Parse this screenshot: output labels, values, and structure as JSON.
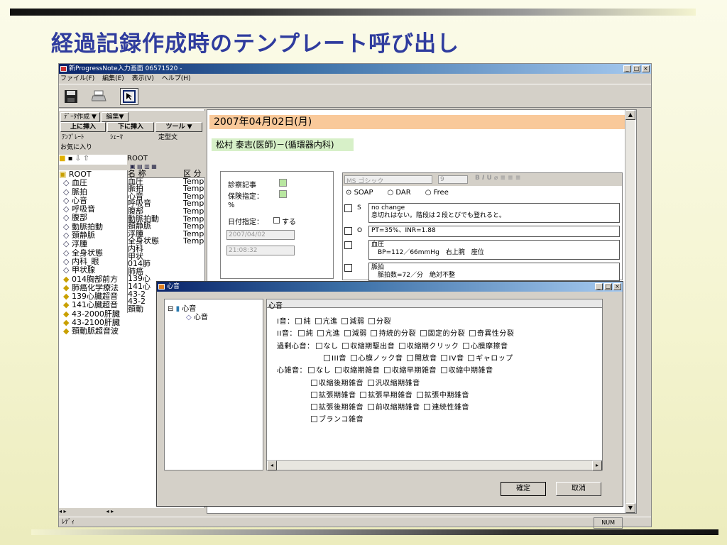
{
  "slide": {
    "title": "経過記録作成時のテンプレート呼び出し"
  },
  "window": {
    "title": "新ProgressNote入力画面 06571520 -",
    "menu": [
      "ファイル(F)",
      "編集(E)",
      "表示(V)",
      "ヘルプ(H)"
    ],
    "status_left": "ﾚﾃﾞｨ",
    "status_num": "NUM"
  },
  "toolbar_icons": [
    "save-icon",
    "print-icon",
    "select-icon"
  ],
  "left": {
    "top_buttons": [
      "ﾃﾞｰﾀ作成 ▼",
      "編集▼"
    ],
    "insert_buttons": [
      "上に挿入",
      "下に挿入",
      "ツール ▼"
    ],
    "tabs": [
      "ﾃﾝﾌﾟﾚｰﾄ",
      "ｼｪｰﾏ",
      "定型文"
    ],
    "favorites": "お気に入り",
    "root_label": "ROOT",
    "tree": [
      "ROOT",
      "血圧",
      "脈拍",
      "心音",
      "呼吸音",
      "腹部",
      "動脈拍動",
      "頚静脈",
      "浮腫",
      "全身状態",
      "内科_眼",
      "甲状腺",
      "014胸部前方",
      "肺癌化学療法",
      "139心臓超音",
      "141心臓超音",
      "43-2000肝臓",
      "43-2100肝臓",
      "頚動脈超音波"
    ],
    "list_header": {
      "name": "名 称",
      "kind": "区 分"
    },
    "list": [
      {
        "name": "血圧",
        "kind": "Temp"
      },
      {
        "name": "脈拍",
        "kind": "Temp"
      },
      {
        "name": "心音",
        "kind": "Temp"
      },
      {
        "name": "呼吸音",
        "kind": "Temp"
      },
      {
        "name": "腹部",
        "kind": "Temp"
      },
      {
        "name": "動脈拍動",
        "kind": "Temp"
      },
      {
        "name": "頚静脈",
        "kind": "Temp"
      },
      {
        "name": "浮腫",
        "kind": "Temp"
      },
      {
        "name": "全身状態",
        "kind": "Temp"
      },
      {
        "name": "内科",
        "kind": ""
      },
      {
        "name": "甲状",
        "kind": ""
      },
      {
        "name": "014肺",
        "kind": ""
      },
      {
        "name": "肺癌",
        "kind": ""
      },
      {
        "name": "139心",
        "kind": ""
      },
      {
        "name": "141心",
        "kind": ""
      },
      {
        "name": "43-2",
        "kind": ""
      },
      {
        "name": "43-2",
        "kind": ""
      },
      {
        "name": "頚動",
        "kind": ""
      }
    ]
  },
  "main": {
    "date": "2007年04月02日(月)",
    "doctor": "松村 泰志(医師)－(循環器内科)",
    "form": {
      "exam": "診察記事",
      "insurance": "保険指定：",
      "percent": "%",
      "date_spec": "日付指定：",
      "date_check": "する",
      "date_value": "2007/04/02",
      "time_value": "21:08:32"
    },
    "editor": {
      "font": "MS ゴシック",
      "size": "9",
      "radios": [
        "SOAP",
        "DAR",
        "Free"
      ],
      "entries": [
        {
          "letter": "S",
          "lines": [
            "no change",
            "息切れはない。階段は２段とびでも登れると。"
          ]
        },
        {
          "letter": "O",
          "lines": [
            "PT=35%、INR=1.88"
          ]
        },
        {
          "letter": "",
          "lines": [
            "血圧",
            "　BP=112／66mmHg　右上腕　座位"
          ]
        },
        {
          "letter": "",
          "lines": [
            "脈拍",
            "　脈拍数=72／分　絶対不整"
          ]
        }
      ]
    }
  },
  "dialog": {
    "title": "心音",
    "tree": [
      "心音",
      "心音"
    ],
    "panel_title": "心音",
    "rows": [
      {
        "label": "I音：",
        "items": [
          "純",
          "亢進",
          "減弱",
          "分裂"
        ]
      },
      {
        "label": "II音：",
        "items": [
          "純",
          "亢進",
          "減弱",
          "持続的分裂",
          "固定的分裂",
          "奇異性分裂"
        ]
      },
      {
        "label": "過剰心音：",
        "items": [
          "なし",
          "収縮期駆出音",
          "収縮期クリック",
          "心膜摩擦音"
        ]
      },
      {
        "label": "",
        "items": [
          "III音",
          "心膜ノック音",
          "開放音",
          "IV音",
          "ギャロップ"
        ]
      },
      {
        "label": "心雑音：",
        "items": [
          "なし",
          "収縮期雑音",
          "収縮早期雑音",
          "収縮中期雑音"
        ]
      },
      {
        "label": "",
        "items": [
          "収縮後期雑音",
          "汎収縮期雑音"
        ]
      },
      {
        "label": "",
        "items": [
          "拡張期雑音",
          "拡張早期雑音",
          "拡張中期雑音"
        ]
      },
      {
        "label": "",
        "items": [
          "拡張後期雑音",
          "前収縮期雑音",
          "連続性雑音"
        ]
      },
      {
        "label": "",
        "items": [
          "ブランコ雑音"
        ]
      }
    ],
    "ok": "確定",
    "cancel": "取消"
  }
}
